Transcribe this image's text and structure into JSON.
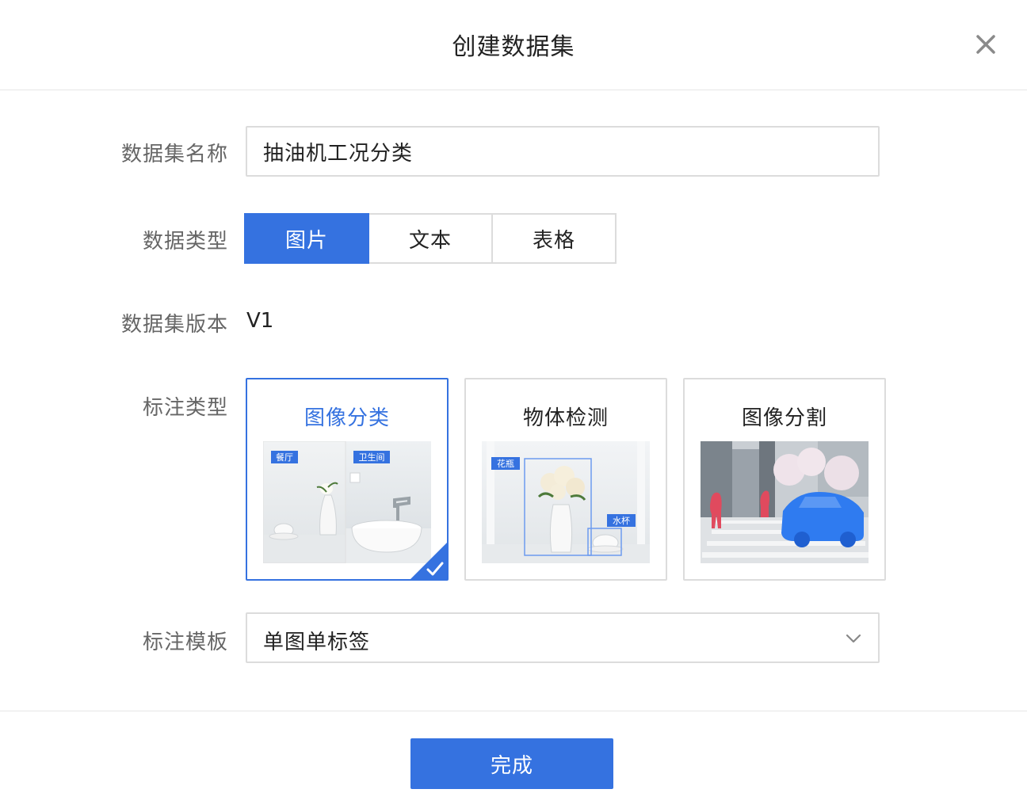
{
  "dialog": {
    "title": "创建数据集",
    "close_icon": "close-icon"
  },
  "form": {
    "name_label": "数据集名称",
    "name_value": "抽油机工况分类",
    "type_label": "数据类型",
    "type_options": [
      "图片",
      "文本",
      "表格"
    ],
    "type_selected": "图片",
    "version_label": "数据集版本",
    "version_value": "V1",
    "annotation_label": "标注类型",
    "annotation_types": [
      {
        "title": "图像分类",
        "tags": [
          "餐厅",
          "卫生间"
        ],
        "selected": true
      },
      {
        "title": "物体检测",
        "tags": [
          "花瓶",
          "水杯"
        ],
        "selected": false
      },
      {
        "title": "图像分割",
        "tags": [],
        "selected": false
      }
    ],
    "template_label": "标注模板",
    "template_value": "单图单标签",
    "template_icon": "chevron-down-icon"
  },
  "footer": {
    "done_label": "完成"
  },
  "colors": {
    "accent": "#3572e0",
    "border": "#dcdcdc",
    "label": "#666666",
    "text": "#222222"
  }
}
